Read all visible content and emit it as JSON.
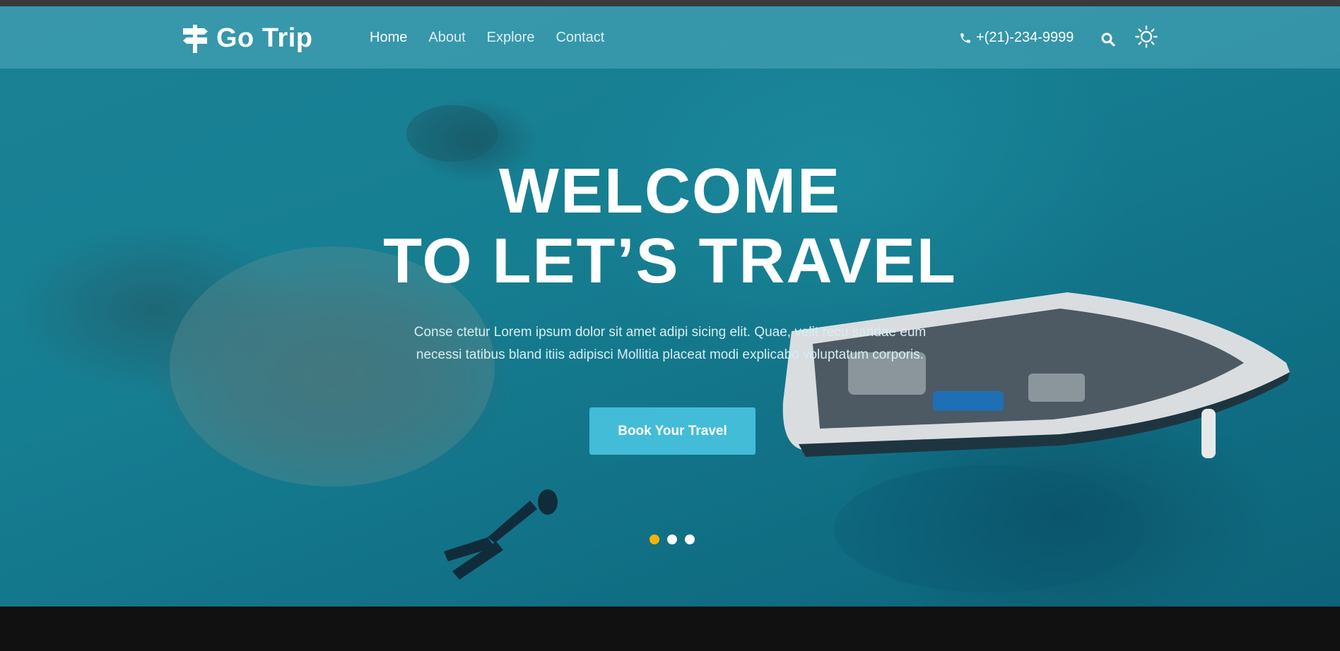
{
  "brand": {
    "name": "Go Trip",
    "icon": "signpost-icon"
  },
  "nav": {
    "items": [
      {
        "label": "Home",
        "active": true
      },
      {
        "label": "About",
        "active": false
      },
      {
        "label": "Explore",
        "active": false
      },
      {
        "label": "Contact",
        "active": false
      }
    ]
  },
  "contact": {
    "phone": "+(21)-234-9999",
    "icon": "phone-icon"
  },
  "toolbar": {
    "search_icon": "search-icon",
    "theme_icon": "sun-icon"
  },
  "hero": {
    "title_line1": "WELCOME",
    "title_line2": "TO LET’S TRAVEL",
    "description_line1": "Conse ctetur Lorem ipsum dolor sit amet adipi sicing elit. Quae, velit recu sandae eum",
    "description_line2": "necessi tatibus bland itiis adipisci Mollitia placeat modi explicabo voluptatum corporis.",
    "cta_label": "Book Your Travel",
    "slides": [
      {
        "active": true
      },
      {
        "active": false
      },
      {
        "active": false
      }
    ]
  },
  "colors": {
    "accent": "#43bcd8",
    "dot_active": "#f4b400",
    "navbar": "#50aabe"
  }
}
